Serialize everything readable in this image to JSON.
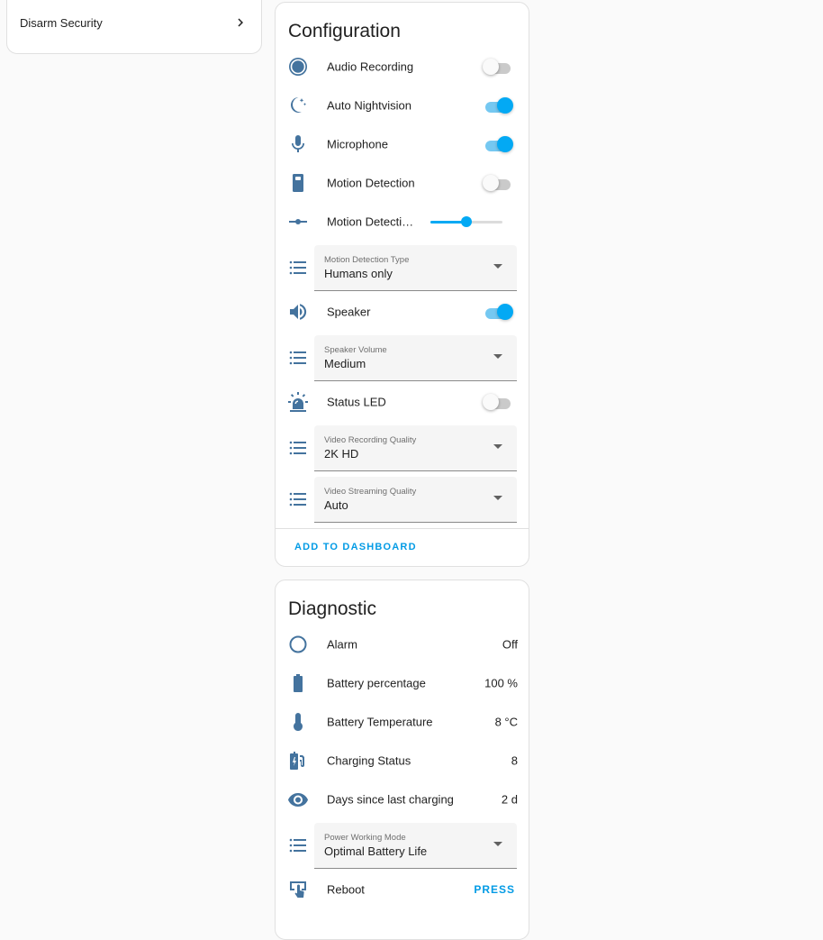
{
  "left_card": {
    "disarm_label": "Disarm Security"
  },
  "configuration": {
    "title": "Configuration",
    "audio_recording": {
      "label": "Audio Recording",
      "on": false
    },
    "auto_nightvision": {
      "label": "Auto Nightvision",
      "on": true
    },
    "microphone": {
      "label": "Microphone",
      "on": true
    },
    "motion_detection": {
      "label": "Motion Detection",
      "on": false
    },
    "motion_sensitivity": {
      "label": "Motion Detecti…",
      "level": 0.5
    },
    "motion_detection_type": {
      "label": "Motion Detection Type",
      "value": "Humans only"
    },
    "speaker": {
      "label": "Speaker",
      "on": true
    },
    "speaker_volume": {
      "label": "Speaker Volume",
      "value": "Medium"
    },
    "status_led": {
      "label": "Status LED",
      "on": false
    },
    "video_recording_quality": {
      "label": "Video Recording Quality",
      "value": "2K HD"
    },
    "video_streaming_quality": {
      "label": "Video Streaming Quality",
      "value": "Auto"
    },
    "add_to_dashboard": "ADD TO DASHBOARD"
  },
  "diagnostic": {
    "title": "Diagnostic",
    "alarm": {
      "label": "Alarm",
      "value": "Off"
    },
    "battery_percentage": {
      "label": "Battery percentage",
      "value": "100 %"
    },
    "battery_temperature": {
      "label": "Battery Temperature",
      "value": "8 °C"
    },
    "charging_status": {
      "label": "Charging Status",
      "value": "8"
    },
    "days_since_charging": {
      "label": "Days since last charging",
      "value": "2 d"
    },
    "power_working_mode": {
      "label": "Power Working Mode",
      "value": "Optimal Battery Life"
    },
    "reboot": {
      "label": "Reboot",
      "action": "PRESS"
    }
  },
  "colors": {
    "accent": "#03a9f4",
    "icon": "#44739e",
    "link": "#039be5"
  }
}
